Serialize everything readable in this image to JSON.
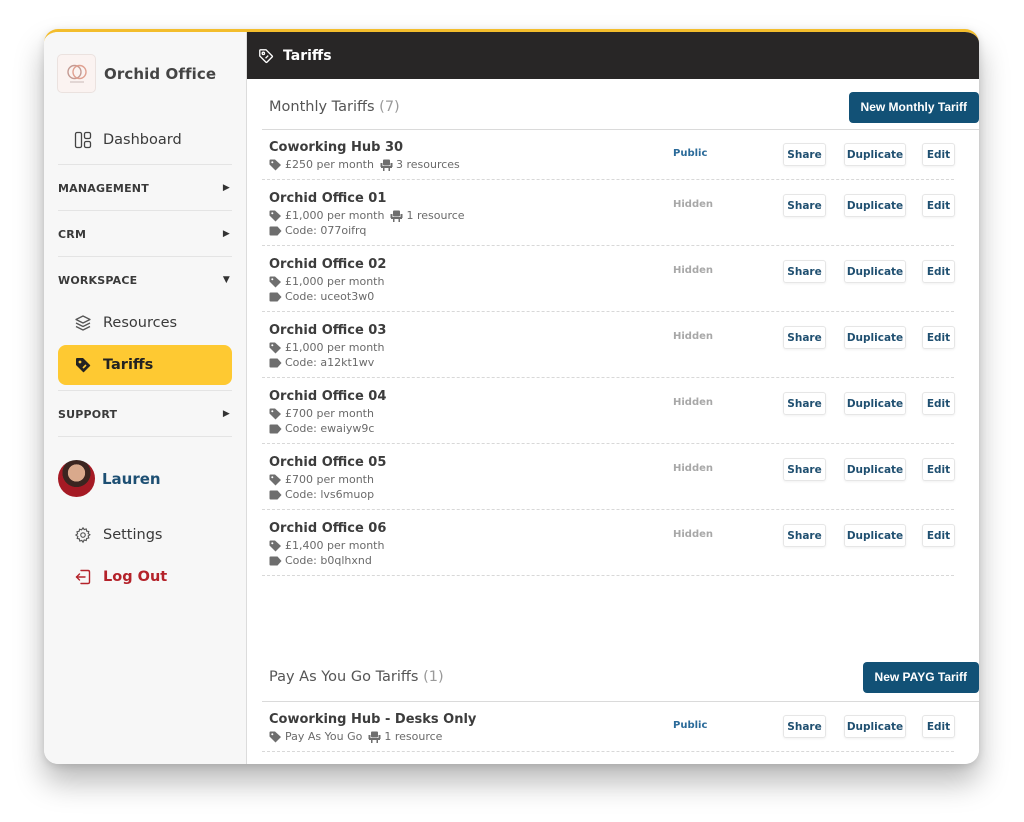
{
  "brand": {
    "name": "Orchid Office",
    "logo_icon": "intertwined-rings-logo"
  },
  "sidebar": {
    "dashboard": {
      "label": "Dashboard",
      "icon": "dashboard-icon"
    },
    "sections": [
      {
        "label": "MANAGEMENT",
        "state": "collapsed"
      },
      {
        "label": "CRM",
        "state": "collapsed"
      },
      {
        "label": "WORKSPACE",
        "state": "expanded"
      },
      {
        "label": "SUPPORT",
        "state": "collapsed"
      }
    ],
    "workspace_items": [
      {
        "label": "Resources",
        "icon": "layers-icon",
        "active": false
      },
      {
        "label": "Tariffs",
        "icon": "tag-icon",
        "active": true
      }
    ],
    "user": {
      "name": "Lauren"
    },
    "settings": {
      "label": "Settings",
      "icon": "gear-icon"
    },
    "logout": {
      "label": "Log Out",
      "icon": "logout-icon"
    }
  },
  "topbar": {
    "title": "Tariffs",
    "icon": "tag-outline-icon"
  },
  "monthly": {
    "title": "Monthly Tariffs",
    "count": "(7)",
    "new_button": "New Monthly Tariff",
    "rows": [
      {
        "name": "Coworking Hub 30",
        "price": "£250 per month",
        "resources": "3 resources",
        "code": null,
        "status": "Public"
      },
      {
        "name": "Orchid Office 01",
        "price": "£1,000 per month",
        "resources": "1 resource",
        "code": "Code: 077oifrq",
        "status": "Hidden"
      },
      {
        "name": "Orchid Office 02",
        "price": "£1,000 per month",
        "resources": null,
        "code": "Code: uceot3w0",
        "status": "Hidden"
      },
      {
        "name": "Orchid Office 03",
        "price": "£1,000 per month",
        "resources": null,
        "code": "Code: a12kt1wv",
        "status": "Hidden"
      },
      {
        "name": "Orchid Office 04",
        "price": "£700 per month",
        "resources": null,
        "code": "Code: ewaiyw9c",
        "status": "Hidden"
      },
      {
        "name": "Orchid Office 05",
        "price": "£700 per month",
        "resources": null,
        "code": "Code: lvs6muop",
        "status": "Hidden"
      },
      {
        "name": "Orchid Office 06",
        "price": "£1,400 per month",
        "resources": null,
        "code": "Code: b0qlhxnd",
        "status": "Hidden"
      }
    ]
  },
  "payg": {
    "title": "Pay As You Go Tariffs",
    "count": "(1)",
    "new_button": "New PAYG Tariff",
    "rows": [
      {
        "name": "Coworking Hub - Desks Only",
        "price": "Pay As You Go",
        "resources": "1 resource",
        "code": null,
        "status": "Public"
      }
    ]
  },
  "row_actions": {
    "share": "Share",
    "duplicate": "Duplicate",
    "edit": "Edit"
  },
  "colors": {
    "accent_yellow": "#fec932",
    "primary_blue": "#125176",
    "topbar_dark": "#282626",
    "public_status": "#2a6a99",
    "hidden_status": "#a8a8a8",
    "logout_red": "#b4222a"
  }
}
